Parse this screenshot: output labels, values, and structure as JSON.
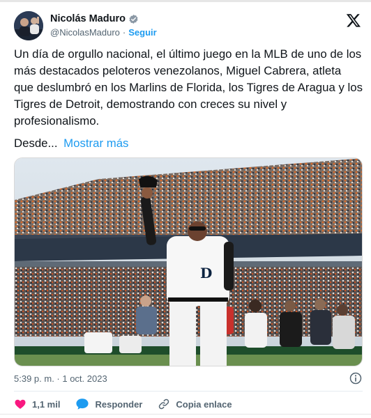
{
  "author": {
    "name": "Nicolás Maduro",
    "handle": "@NicolasMaduro",
    "separator": "·",
    "follow_label": "Seguir"
  },
  "tweet": {
    "text": "Un día de orgullo nacional, el último juego en la MLB de uno de los más destacados peloteros venezolanos, Miguel Cabrera, atleta que deslumbró en los Marlins de Florida, los Tigres de Aragua y los Tigres de Detroit, demostrando con creces su nivel y profesionalismo.",
    "truncated_text": "Desde...",
    "show_more_label": "Mostrar más",
    "timestamp": "5:39 p. m. · 1 oct. 2023"
  },
  "media": {
    "jersey_letter": "D"
  },
  "actions": {
    "likes": "1,1 mil",
    "reply_label": "Responder",
    "copy_link_label": "Copia enlace"
  },
  "colors": {
    "accent": "#1d9bf0",
    "like": "#f91880",
    "text": "#0f1419",
    "secondary": "#536471"
  },
  "icons": [
    "verified-badge-icon",
    "x-logo-icon",
    "info-icon",
    "heart-icon",
    "reply-bubble-icon",
    "link-icon"
  ]
}
